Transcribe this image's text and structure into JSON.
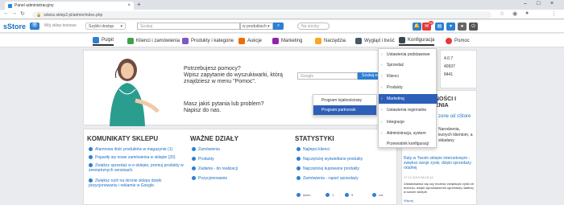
{
  "browser": {
    "tab_title": "Panel administracyjny",
    "url": "sdsisz.sklep2.pl/admin/index.php"
  },
  "header": {
    "logo": "sStore",
    "shop_name": "Mój sklep testowe",
    "quick_access": "Szybki dostęp",
    "search_placeholder": "Szukaj",
    "search_scope": "w produktach",
    "stock_placeholder": "Na stocky",
    "notif_count": "20"
  },
  "nav": {
    "items": [
      {
        "label": "Pulpit",
        "color": "#2d7fd3"
      },
      {
        "label": "Klienci i zamówienia",
        "color": "#43a047"
      },
      {
        "label": "Produkty i kategorie",
        "color": "#7e57c2"
      },
      {
        "label": "Aukcje",
        "color": "#ef6c00"
      },
      {
        "label": "Marketing",
        "color": "#8e24aa"
      },
      {
        "label": "Narzędzia",
        "color": "#f9a825"
      },
      {
        "label": "Wygląd i treść",
        "color": "#455a64"
      },
      {
        "label": "Konfiguracja",
        "color": "#37474f"
      },
      {
        "label": "Pomoc",
        "color": "#e53935"
      }
    ]
  },
  "help": {
    "question_line1": "Potrzebujesz pomocy?",
    "question_line2": "Wpisz zapytanie do wyszukiwarki, którą",
    "question_line3": "znajdziesz w menu \"Pomoc\".",
    "google_placeholder": "Google",
    "google_btn": "Szukaj w pomocy",
    "problem_line1": "Masz jakiś pytania lub problem?",
    "problem_line2": "Napisz do nas."
  },
  "right_panel": {
    "version_a": "4.0.7",
    "version_b": "40937",
    "version_c": "8441",
    "news_title1": "NOŚCI I",
    "news_title2": "ENIA",
    "news_link": "zone od sStore",
    "news_text1": "Narodzenia,",
    "news_text2": "leznych klientom, a",
    "news_text3": "składany",
    "article_title": "Raty w Twoim sklepie internetowym - zwiększ swoje zyski, dzięki sprzedaży ratalnej",
    "article_date": "17.12.2019 08:15:42",
    "article_text": "Zastanawiasz się czy możesz zwiększyć zyski ze biznesu, dzięki wprowadzeniu sprzedaży ratalnej w swoim sklepie.",
    "article_more": "Więcej"
  },
  "sections": {
    "comm_title": "KOMUNIKATY SKLEPU",
    "comm_items": [
      "Alarmowa ilość produktów w magazynie (1)",
      "Pojawiły się nowe zamówienia w sklepie (20)",
      "Zwiększ sprzedaż w e-sklepie, promuj produkty w zewnętrznych serwisach.",
      "Zwiększ ruch na stronie sklepu dzięki pozycjonowaniu i reklamie w Google."
    ],
    "dept_title": "WAŻNE DZIAŁY",
    "dept_items": [
      "Zamówienia",
      "Produkty",
      "Zadania - do realizacji",
      "Pozycjonowanie"
    ],
    "stats_title": "STATYSTYKI",
    "stats_items": [
      "Najlepsi klienci",
      "Najczęściej wyświetlane produkty",
      "Najczęściej kupowane produkty",
      "Zamówienia - raport sprzedaży"
    ],
    "stats_counts": [
      "dzień",
      "1",
      "5",
      "rok"
    ]
  },
  "config_menu": {
    "items": [
      "Ustawienia podstawowe",
      "Sprzedaż",
      "Klienci",
      "Produkty",
      "Marketing",
      "Ustawienia regionalne",
      "Integracje",
      "Administracja, system",
      "Przewodnik konfiguracji"
    ],
    "selected": "Marketing"
  },
  "submenu": {
    "items": [
      "Program lojalnościowy",
      "Program partnerski"
    ],
    "selected": "Program partnerski"
  }
}
